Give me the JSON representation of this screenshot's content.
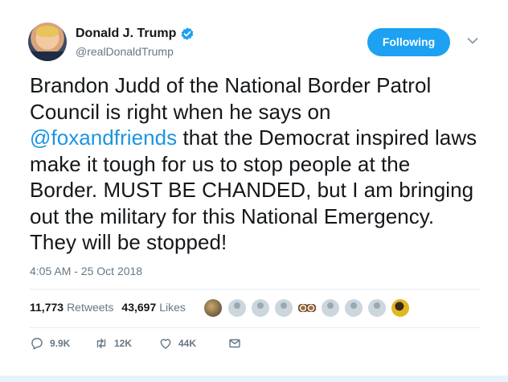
{
  "user": {
    "name": "Donald J. Trump",
    "handle": "@realDonaldTrump",
    "verified": true
  },
  "follow_button": {
    "label": "Following"
  },
  "tweet": {
    "text_before": "Brandon Judd of the National Border Patrol Council is right when he says on ",
    "mention": "@foxandfriends",
    "text_after": " that the Democrat inspired laws make it tough for us to stop people at the Border. MUST BE CHANDED, but I am bringing out the military for this National Emergency. They will be stopped!",
    "timestamp": "4:05 AM - 25 Oct 2018"
  },
  "stats": {
    "retweets_count": "11,773",
    "retweets_label": "Retweets",
    "likes_count": "43,697",
    "likes_label": "Likes"
  },
  "likers": [
    {
      "type": "photo",
      "icon": "profile-photo"
    },
    {
      "type": "default",
      "icon": "default-avatar-icon"
    },
    {
      "type": "default",
      "icon": "default-avatar-icon"
    },
    {
      "type": "default",
      "icon": "default-avatar-icon"
    },
    {
      "type": "photo",
      "icon": "profile-photo"
    },
    {
      "type": "photo",
      "icon": "profile-photo"
    },
    {
      "type": "default",
      "icon": "default-avatar-icon"
    },
    {
      "type": "default",
      "icon": "default-avatar-icon"
    },
    {
      "type": "default",
      "icon": "default-avatar-icon"
    },
    {
      "type": "photo",
      "icon": "profile-photo"
    }
  ],
  "actions": {
    "reply_count": "9.9K",
    "retweet_count": "12K",
    "like_count": "44K"
  },
  "colors": {
    "accent": "#1da1f2",
    "link": "#1b95e0",
    "secondary_text": "#657786"
  }
}
